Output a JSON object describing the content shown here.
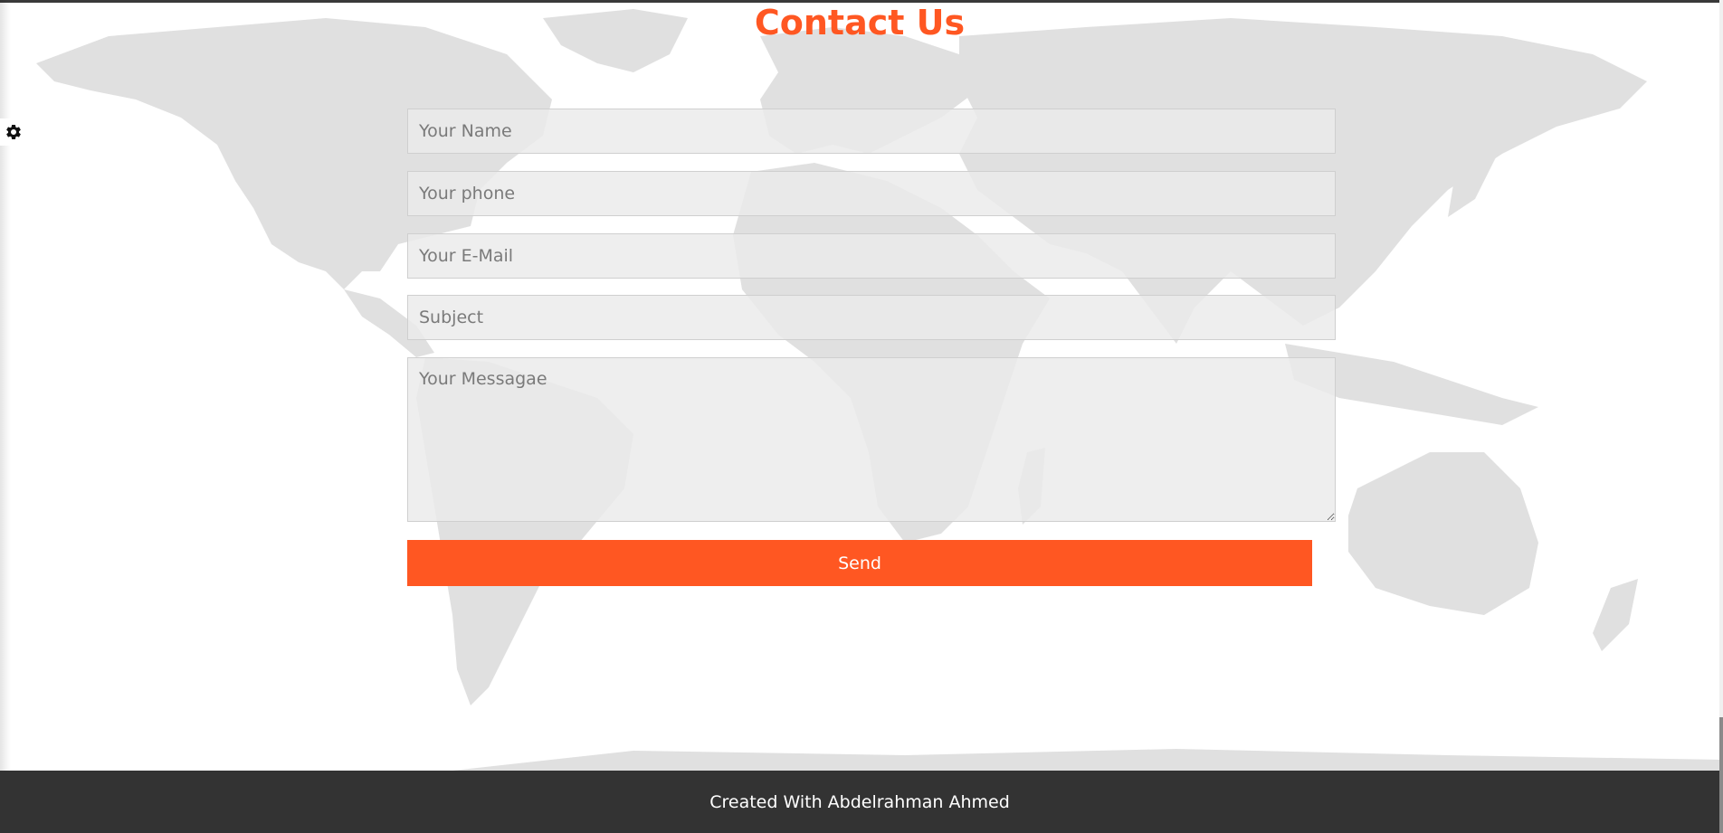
{
  "contact": {
    "title": "Contact Us",
    "name_placeholder": "Your Name",
    "phone_placeholder": "Your phone",
    "email_placeholder": "Your E-Mail",
    "subject_placeholder": "Subject",
    "message_placeholder": "Your Messagae",
    "send_label": "Send"
  },
  "footer": {
    "text": "Created With Abdelrahman Ahmed"
  },
  "icons": {
    "settings": "gear-icon"
  },
  "colors": {
    "accent": "#ff5722",
    "footer_bg": "#333333",
    "map_land": "#dedede",
    "field_bg": "#eaeaea"
  }
}
